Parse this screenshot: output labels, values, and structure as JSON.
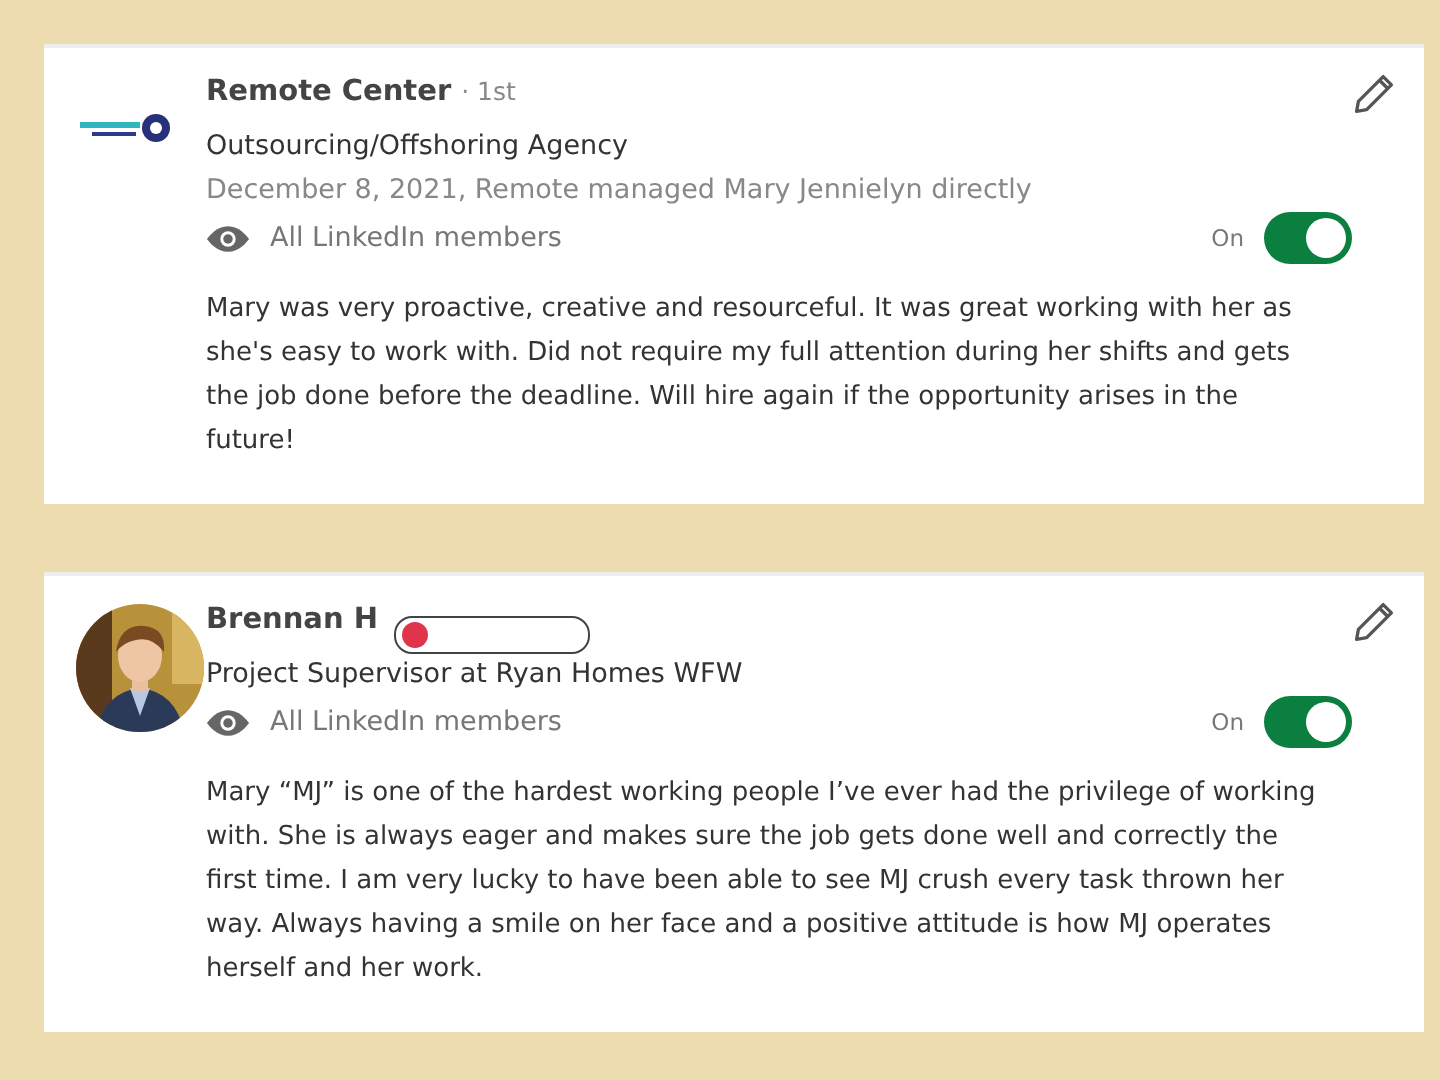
{
  "recommendations": [
    {
      "avatar": {
        "kind": "logo"
      },
      "name": "Remote Center",
      "degree": "· 1st",
      "headline": "Outsourcing/Offshoring Agency",
      "date_line": "December 8, 2021, Remote managed Mary Jennielyn directly",
      "visibility": "All LinkedIn members",
      "toggle_label": "On",
      "on": true,
      "recording_overlay": false,
      "text": "Mary was very proactive, creative and resourceful. It was great working with her as she's easy to work with. Did not require my full attention during her shifts and gets the job done before the deadline. Will hire again if the opportunity arises in the future!"
    },
    {
      "name": "Brennan H",
      "headline": "Project Supervisor at Ryan Homes WFW",
      "visibility": "All LinkedIn members",
      "toggle_label": "On",
      "on": true,
      "recording_overlay": true,
      "text": "Mary “MJ” is one of the hardest working people I’ve ever had the privilege of working with. She is always eager and makes sure the job gets done well and correctly the first time. I am very lucky to have been able to see MJ crush every task thrown her way. Always having a smile on her face and a positive attitude is how MJ operates herself and her work."
    }
  ]
}
